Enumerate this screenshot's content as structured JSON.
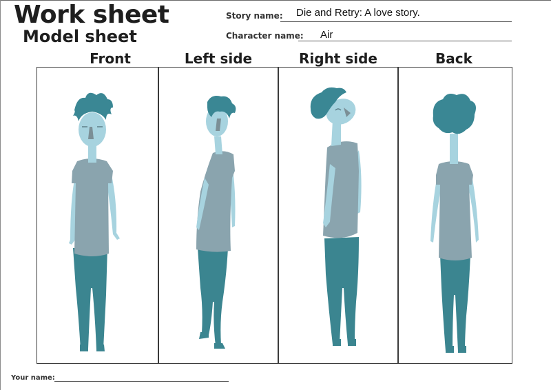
{
  "header": {
    "title": "Work sheet",
    "subtitle": "Model sheet"
  },
  "fields": {
    "story_name_label": "Story name:",
    "story_name_value": "Die and Retry: A love story.",
    "character_name_label": "Character name:",
    "character_name_value": "Air",
    "your_name_label": "Your name:"
  },
  "views": [
    {
      "label": "Front"
    },
    {
      "label": "Left side"
    },
    {
      "label": "Right side"
    },
    {
      "label": "Back"
    }
  ],
  "colors": {
    "hair": "#3a8794",
    "skin": "#a7d3df",
    "shirt": "#8aa4ae",
    "pants": "#3b8590",
    "feature": "#7b8f96"
  }
}
